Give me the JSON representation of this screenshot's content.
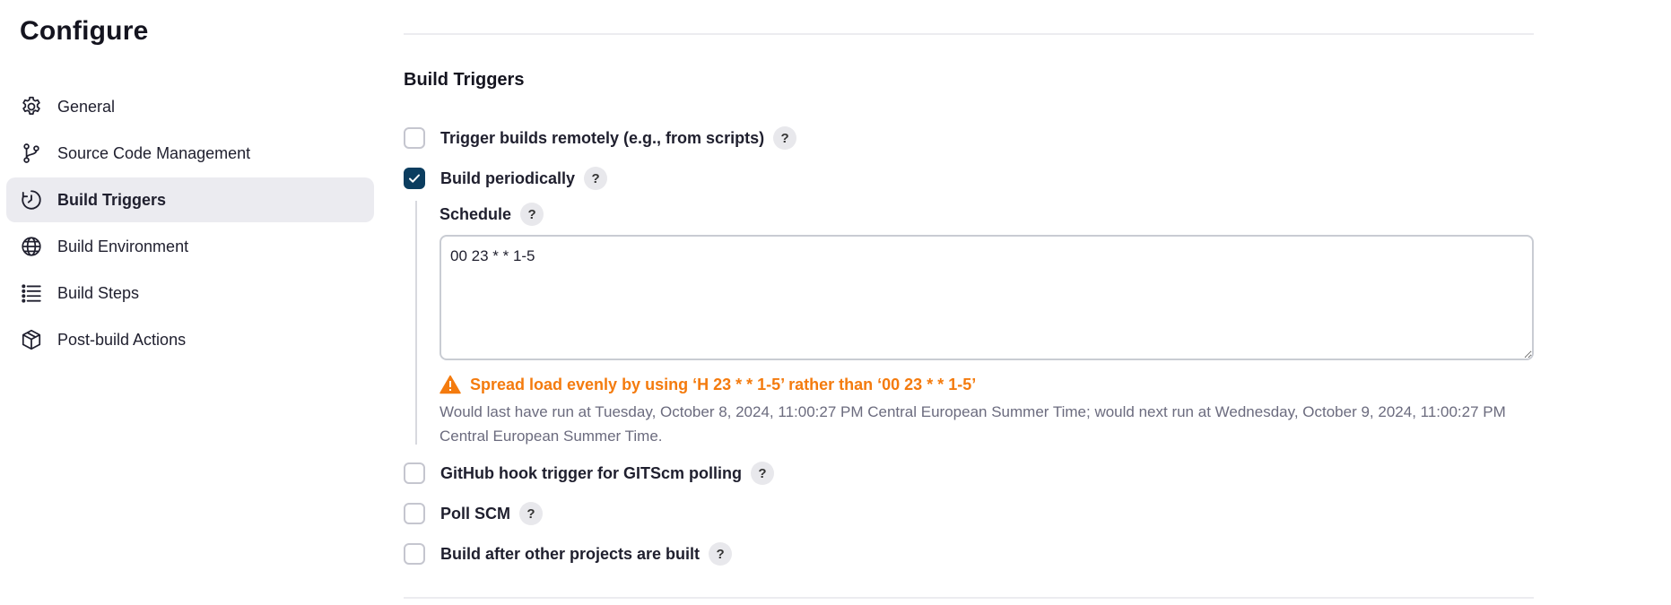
{
  "page_title": "Configure",
  "sidebar": {
    "items": [
      {
        "label": "General",
        "icon": "gear-icon",
        "active": false
      },
      {
        "label": "Source Code Management",
        "icon": "branch-icon",
        "active": false
      },
      {
        "label": "Build Triggers",
        "icon": "clock-icon",
        "active": true
      },
      {
        "label": "Build Environment",
        "icon": "globe-icon",
        "active": false
      },
      {
        "label": "Build Steps",
        "icon": "list-icon",
        "active": false
      },
      {
        "label": "Post-build Actions",
        "icon": "package-icon",
        "active": false
      }
    ]
  },
  "main": {
    "section_title": "Build Triggers",
    "help_label": "?",
    "options": [
      {
        "label": "Trigger builds remotely (e.g., from scripts)",
        "checked": false
      },
      {
        "label": "Build periodically",
        "checked": true
      },
      {
        "label": "GitHub hook trigger for GITScm polling",
        "checked": false
      },
      {
        "label": "Poll SCM",
        "checked": false
      },
      {
        "label": "Build after other projects are built",
        "checked": false
      }
    ],
    "schedule": {
      "label": "Schedule",
      "value": "00 23 * * 1-5",
      "warning": "Spread load evenly by using ‘H 23 * * 1-5’ rather than ‘00 23 * * 1-5’",
      "info": "Would last have run at Tuesday, October 8, 2024, 11:00:27 PM Central European Summer Time; would next run at Wednesday, October 9, 2024, 11:00:27 PM Central European Summer Time."
    }
  },
  "colors": {
    "checkbox_checked": "#0b3d5f",
    "warning": "#f47b0e",
    "active_nav_bg": "#ebebf0"
  }
}
